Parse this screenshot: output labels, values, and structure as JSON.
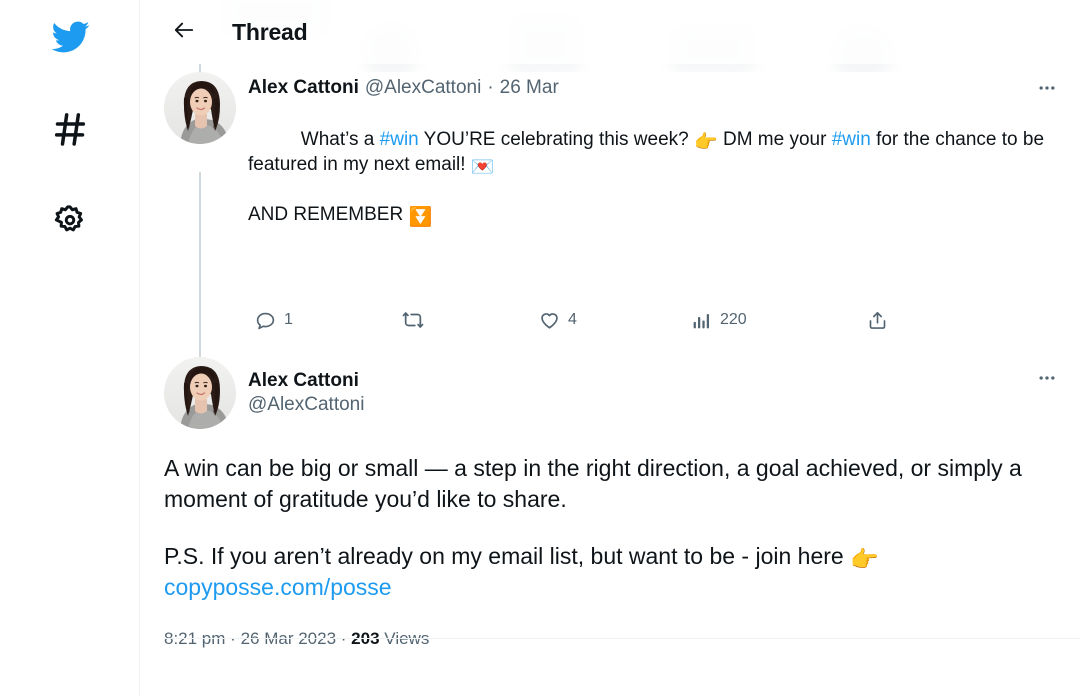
{
  "sidebar": {
    "items": [
      {
        "icon": "twitter-bird-icon",
        "name": "home-logo",
        "color": "#1d9bf0"
      },
      {
        "icon": "hashtag-icon",
        "name": "explore",
        "color": "#0f1419"
      },
      {
        "icon": "gear-icon",
        "name": "settings",
        "color": "#0f1419"
      }
    ]
  },
  "header": {
    "back_icon": "back-arrow-icon",
    "title": "Thread"
  },
  "colors": {
    "accent": "#1d9bf0",
    "text": "#0f1419",
    "muted": "#536471",
    "divider": "#eff3f4",
    "thread_line": "#cfd9de"
  },
  "tweets": [
    {
      "author": "Alex Cattoni",
      "handle": "@AlexCattoni",
      "separator": "·",
      "date": "26 Mar",
      "more_label": "•••",
      "text_parts": [
        {
          "type": "text",
          "value": "What’s a "
        },
        {
          "type": "link",
          "value": "#win"
        },
        {
          "type": "text",
          "value": " YOU’RE celebrating this week? "
        },
        {
          "type": "emoji",
          "value": "👉"
        },
        {
          "type": "text",
          "value": " DM me your "
        },
        {
          "type": "link",
          "value": "#win"
        },
        {
          "type": "text",
          "value": " for the chance to be featured in my next email! "
        },
        {
          "type": "emoji",
          "value": "💌"
        }
      ],
      "text_line2": "AND REMEMBER ",
      "text_line2_emoji": "⏬",
      "actions": [
        {
          "name": "reply",
          "icon": "reply-icon",
          "count": "1"
        },
        {
          "name": "retweet",
          "icon": "retweet-icon",
          "count": ""
        },
        {
          "name": "like",
          "icon": "heart-icon",
          "count": "4"
        },
        {
          "name": "views",
          "icon": "analytics-icon",
          "count": "220"
        },
        {
          "name": "share",
          "icon": "share-icon",
          "count": ""
        }
      ]
    },
    {
      "author": "Alex Cattoni",
      "handle": "@AlexCattoni",
      "more_label": "•••",
      "body_line1": "A win can be big or small — a step in the right direction, a goal achieved, or simply a moment of gratitude you’d like to share.",
      "body_line2_pre": "P.S. If you aren’t already on my email list, but want to be - join here ",
      "body_line2_emoji": "👉",
      "body_link": "copyposse.com/posse",
      "time": "8:21 pm",
      "sep1": "·",
      "date": "26 Mar 2023",
      "sep2": "·",
      "views_count": "203",
      "views_label": "Views"
    }
  ]
}
